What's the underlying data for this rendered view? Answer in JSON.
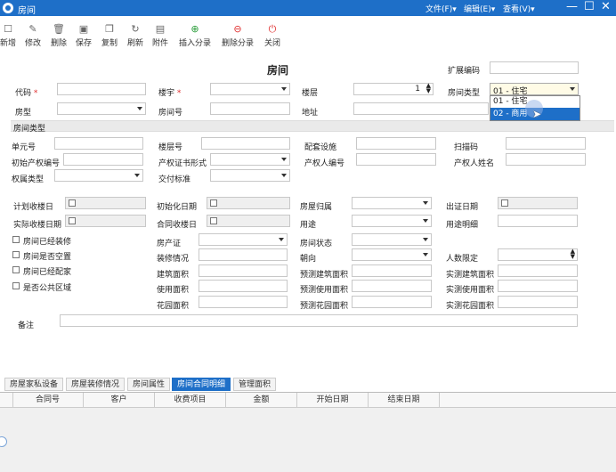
{
  "window": {
    "title": "房间",
    "menus": [
      "文件(F)▾",
      "编辑(E)▾",
      "查看(V)▾"
    ]
  },
  "toolbar": [
    {
      "label": "新增",
      "icon": "new-icon",
      "glyph": "☐"
    },
    {
      "label": "修改",
      "icon": "edit-icon",
      "glyph": "✎"
    },
    {
      "label": "删除",
      "icon": "delete-icon",
      "glyph": "🗑"
    },
    {
      "label": "保存",
      "icon": "save-icon",
      "glyph": "▣"
    },
    {
      "label": "复制",
      "icon": "copy-icon",
      "glyph": "❐"
    },
    {
      "label": "刷新",
      "icon": "refresh-icon",
      "glyph": "↻"
    },
    {
      "label": "附件",
      "icon": "attachment-icon",
      "glyph": "▤"
    },
    {
      "label": "插入分录",
      "icon": "insert-row-icon",
      "glyph": "⊕"
    },
    {
      "label": "删除分录",
      "icon": "delete-row-icon",
      "glyph": "⊖"
    },
    {
      "label": "关闭",
      "icon": "power-icon",
      "glyph": "⏻"
    }
  ],
  "form": {
    "heading": "房间",
    "ext_code_label": "扩展编码",
    "code_label": "代码",
    "building_label": "楼宇",
    "floor_label": "楼层",
    "floor_value": "1",
    "room_type_label": "房间类型",
    "room_type_value": "01 - 住宅",
    "room_type_options": [
      "01 - 住宅",
      "02 - 商用"
    ],
    "layout_label": "房型",
    "room_no_label": "房间号",
    "address_label": "地址",
    "section_title": "房间类型",
    "unit_no": "单元号",
    "floor_no": "楼层号",
    "facilities": "配套设施",
    "scan_code": "扫描码",
    "initial_cert_no": "初始产权编号",
    "cert_form": "产权证书形式",
    "owner_no": "产权人编号",
    "owner_name": "产权人姓名",
    "ownership_type": "权属类型",
    "delivery_std": "交付标准",
    "plan_receive_date": "计划收楼日",
    "init_date": "初始化日期",
    "house_belong": "房屋归属",
    "cert_date": "出证日期",
    "actual_receive_date": "实际收楼日期",
    "contract_receive_date": "合同收楼日",
    "usage": "用途",
    "usage_detail": "用途明细",
    "renovated": "房间已经装修",
    "vacant": "房间是否空置",
    "furnished": "房间已经配家",
    "public_area": "是否公共区域",
    "property_cert": "房产证",
    "renovation_status": "装修情况",
    "building_area": "建筑面积",
    "usable_area": "使用面积",
    "garden_area": "花园面积",
    "room_status": "房间状态",
    "orientation": "朝向",
    "pred_building_area": "预测建筑面积",
    "pred_usable_area": "预测使用面积",
    "pred_garden_area": "预测花园面积",
    "occupancy_limit": "人数限定",
    "actual_building_area": "实测建筑面积",
    "actual_usable_area": "实测使用面积",
    "actual_garden_area": "实测花园面积",
    "remarks": "备注"
  },
  "tabs": [
    "房屋家私设备",
    "房屋装修情况",
    "房间属性",
    "房间合同明细",
    "管理面积"
  ],
  "active_tab": "房间合同明细",
  "table": {
    "columns": [
      "合同号",
      "客户",
      "收费项目",
      "金额",
      "开始日期",
      "结束日期"
    ]
  }
}
